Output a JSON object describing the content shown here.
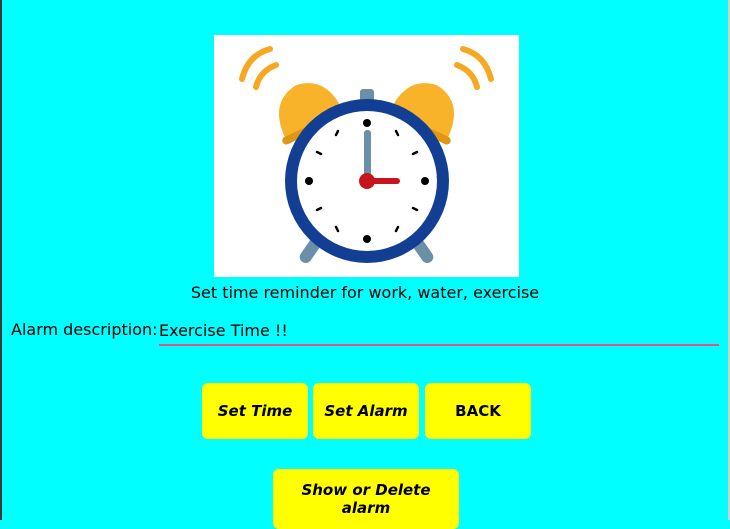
{
  "header": {
    "subtitle": "Set time reminder for work, water, exercise"
  },
  "alarm": {
    "description_label": "Alarm description:",
    "description_value": "Exercise Time !!",
    "accent_color": "#e0558e"
  },
  "buttons": {
    "set_time": "Set Time",
    "set_alarm": "Set Alarm",
    "back": "BACK",
    "show_or_delete": "Show or Delete alarm"
  },
  "theme": {
    "background": "#00ffff",
    "button_color": "#ffff00"
  },
  "image": {
    "icon": "alarm-clock-icon"
  }
}
